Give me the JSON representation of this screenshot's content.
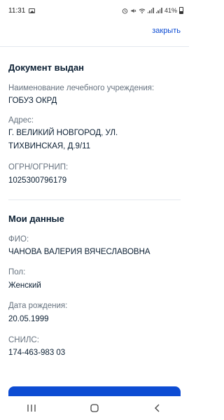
{
  "status_bar": {
    "time": "11:31",
    "battery_percent": "41%"
  },
  "header": {
    "close_label": "закрыть"
  },
  "document_issued": {
    "title": "Документ выдан",
    "institution_label": "Наименование лечебного учреждения:",
    "institution_value": "ГОБУЗ ОКРД",
    "address_label": "Адрес:",
    "address_value": "Г. ВЕЛИКИЙ НОВГОРОД, УЛ. ТИХВИНСКАЯ, Д.9/11",
    "ogrn_label": "ОГРН/ОГРНИП:",
    "ogrn_value": "1025300796179"
  },
  "my_data": {
    "title": "Мои данные",
    "fio_label": "ФИО:",
    "fio_value": "ЧАНОВА ВАЛЕРИЯ ВЯЧЕСЛАВОВНА",
    "sex_label": "Пол:",
    "sex_value": "Женский",
    "birth_label": "Дата рождения:",
    "birth_value": "20.05.1999",
    "snils_label": "СНИЛС:",
    "snils_value": "174-463-983 03"
  },
  "colors": {
    "accent": "#0d4cd3",
    "text": "#0b1f33",
    "muted": "#66727f"
  },
  "nav_icons": [
    "recent-apps-icon",
    "home-icon",
    "back-icon"
  ]
}
